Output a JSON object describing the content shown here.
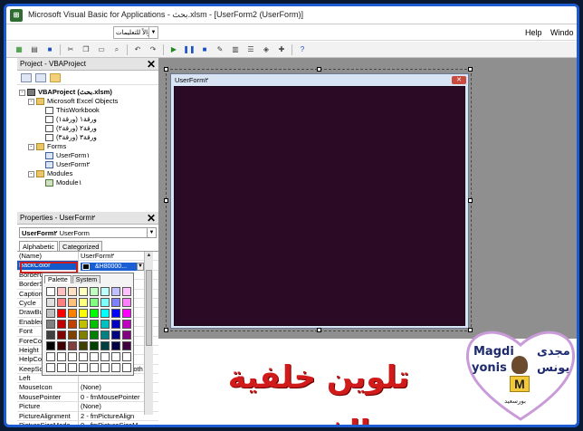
{
  "window": {
    "title": "Microsoft Visual Basic for Applications - بحث.xlsm - [UserForm2 (UserForm)]",
    "app_icon": "vba-icon"
  },
  "menubar": {
    "search_placeholder": "اكتب سؤالاً للتعليمات",
    "items": [
      "Help",
      "Windo"
    ]
  },
  "project_pane": {
    "title": "Project - VBAProject",
    "tree": [
      {
        "label": "VBAProject (بحث.xlsm)",
        "level": 0,
        "icon": "project-icon",
        "expander": "-"
      },
      {
        "label": "Microsoft Excel Objects",
        "level": 1,
        "icon": "folder-icon",
        "expander": "-"
      },
      {
        "label": "ThisWorkbook",
        "level": 2,
        "icon": "sheet-icon",
        "expander": ""
      },
      {
        "label": "ورقة١ (ورقة١)",
        "level": 2,
        "icon": "sheet-icon",
        "expander": ""
      },
      {
        "label": "ورقة٢ (ورقة٢)",
        "level": 2,
        "icon": "sheet-icon",
        "expander": ""
      },
      {
        "label": "ورقة٣ (ورقة٣)",
        "level": 2,
        "icon": "sheet-icon",
        "expander": ""
      },
      {
        "label": "Forms",
        "level": 1,
        "icon": "folder-icon",
        "expander": "-"
      },
      {
        "label": "UserForm١",
        "level": 2,
        "icon": "form-icon",
        "expander": ""
      },
      {
        "label": "UserForm٢",
        "level": 2,
        "icon": "form-icon",
        "expander": ""
      },
      {
        "label": "Modules",
        "level": 1,
        "icon": "folder-icon",
        "expander": "-"
      },
      {
        "label": "Module١",
        "level": 2,
        "icon": "module-icon",
        "expander": ""
      }
    ]
  },
  "properties_pane": {
    "title": "Properties - UserForm٢",
    "object_name": "UserForm٢",
    "object_type": "UserForm",
    "tabs": [
      "Alphabetic",
      "Categorized"
    ],
    "selected_tab": "Alphabetic",
    "selected_value": "&H80000...",
    "rows": [
      {
        "name": "(Name)",
        "value": "UserForm٢"
      },
      {
        "name": "BackColor",
        "value": ""
      },
      {
        "name": "BorderColor",
        "value": ""
      },
      {
        "name": "BorderStyle",
        "value": ""
      },
      {
        "name": "Caption",
        "value": ""
      },
      {
        "name": "Cycle",
        "value": ""
      },
      {
        "name": "DrawBuffer",
        "value": ""
      },
      {
        "name": "Enabled",
        "value": ""
      },
      {
        "name": "Font",
        "value": ""
      },
      {
        "name": "ForeColor",
        "value": ""
      },
      {
        "name": "Height",
        "value": ""
      },
      {
        "name": "HelpContextID",
        "value": ""
      },
      {
        "name": "KeepScrollBarsVisible",
        "value": "3 - fmScrollBarsBoth"
      },
      {
        "name": "Left",
        "value": ""
      },
      {
        "name": "MouseIcon",
        "value": "(None)"
      },
      {
        "name": "MousePointer",
        "value": "0 - fmMousePointer"
      },
      {
        "name": "Picture",
        "value": "(None)"
      },
      {
        "name": "PictureAlignment",
        "value": "2 - fmPictureAlign"
      },
      {
        "name": "PictureSizeMode",
        "value": "0 - fmPictureSizeM"
      }
    ],
    "palette": {
      "tabs": [
        "Palette",
        "System"
      ],
      "selected_tab": "Palette",
      "colors": [
        "#ffffff",
        "#ffc0c0",
        "#ffe0c0",
        "#ffffc0",
        "#c0ffc0",
        "#c0ffff",
        "#c0c0ff",
        "#ffc0ff",
        "#e0e0e0",
        "#ff8080",
        "#ffc080",
        "#ffff80",
        "#80ff80",
        "#80ffff",
        "#8080ff",
        "#ff80ff",
        "#c0c0c0",
        "#ff0000",
        "#ff8000",
        "#ffff00",
        "#00ff00",
        "#00ffff",
        "#0000ff",
        "#ff00ff",
        "#808080",
        "#c00000",
        "#c04000",
        "#c0c000",
        "#00c000",
        "#00c0c0",
        "#0000c0",
        "#c000c0",
        "#404040",
        "#800000",
        "#804000",
        "#808000",
        "#008000",
        "#008080",
        "#000080",
        "#800080",
        "#000000",
        "#400000",
        "#804040",
        "#404000",
        "#004000",
        "#004040",
        "#000040",
        "#400040",
        "#ffffff",
        "#ffffff",
        "#ffffff",
        "#ffffff",
        "#ffffff",
        "#ffffff",
        "#ffffff",
        "#ffffff",
        "#ffffff",
        "#ffffff",
        "#ffffff",
        "#ffffff",
        "#ffffff",
        "#ffffff",
        "#ffffff",
        "#ffffff"
      ]
    }
  },
  "designer": {
    "form_caption": "UserForm٢",
    "form_back_color": "#2a0a24"
  },
  "overlay": {
    "arabic_title": "تلوين خلفية الفورم",
    "logo_en_line1": "Magdi",
    "logo_en_line2": "yonis",
    "logo_ar_line1": "مجدى",
    "logo_ar_line2": "يونس",
    "logo_letter": "M",
    "logo_sub": "بورسعيد"
  },
  "colors": {
    "accent_border": "#1c5bd1",
    "highlight_red": "#d01a1a",
    "selection_blue": "#1459c9"
  }
}
